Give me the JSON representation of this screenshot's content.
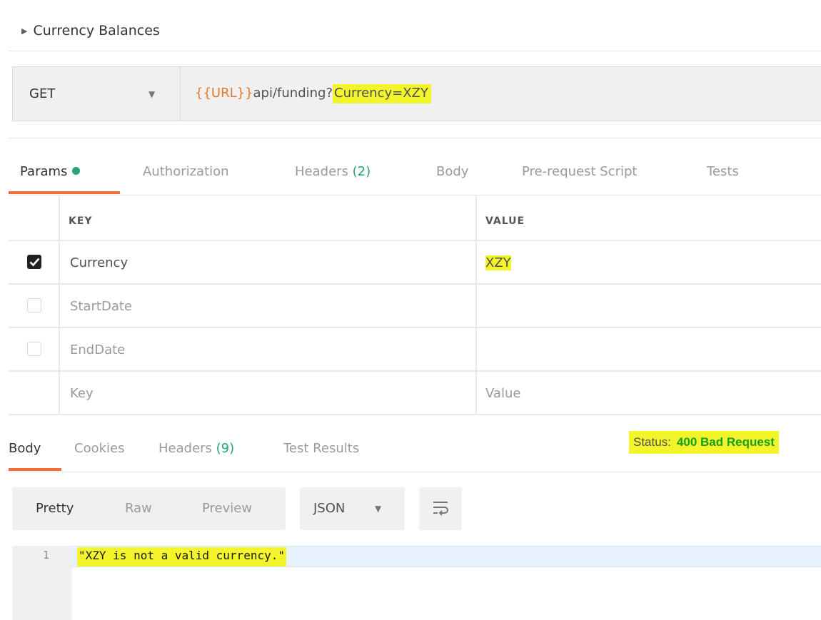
{
  "collection": {
    "caret": "▶",
    "title": "Currency Balances"
  },
  "request": {
    "method": "GET",
    "url_variable": "{{URL}}",
    "url_path": "api/funding?",
    "url_query": "Currency=XZY"
  },
  "request_tabs": [
    {
      "label": "Params",
      "active": true
    },
    {
      "label": "Authorization"
    },
    {
      "label": "Headers",
      "count": "(2)"
    },
    {
      "label": "Body"
    },
    {
      "label": "Pre-request Script"
    },
    {
      "label": "Tests"
    }
  ],
  "params": {
    "headers": {
      "key": "KEY",
      "value": "VALUE"
    },
    "rows": [
      {
        "checked": true,
        "key": "Currency",
        "value": "XZY"
      },
      {
        "checked": false,
        "key": "StartDate",
        "value": ""
      },
      {
        "checked": false,
        "key": "EndDate",
        "value": ""
      }
    ],
    "placeholder": {
      "key": "Key",
      "value": "Value"
    }
  },
  "response_tabs": [
    {
      "label": "Body",
      "active": true
    },
    {
      "label": "Cookies"
    },
    {
      "label": "Headers",
      "count": "(9)"
    },
    {
      "label": "Test Results"
    }
  ],
  "status": {
    "label": "Status:",
    "value": "400 Bad Request"
  },
  "view_modes": [
    "Pretty",
    "Raw",
    "Preview"
  ],
  "format": "JSON",
  "editor": {
    "line_number": "1",
    "line": "\"XZY is not a valid currency.\""
  },
  "colors": {
    "accent": "#f26b3a",
    "count": "#27a27a",
    "status_ok": "#14a014",
    "highlight": "#f3f52a",
    "url_variable": "#e8782f"
  },
  "icons": [
    "caret-right-icon",
    "chevron-down-icon",
    "check-icon",
    "wrap-lines-icon"
  ]
}
